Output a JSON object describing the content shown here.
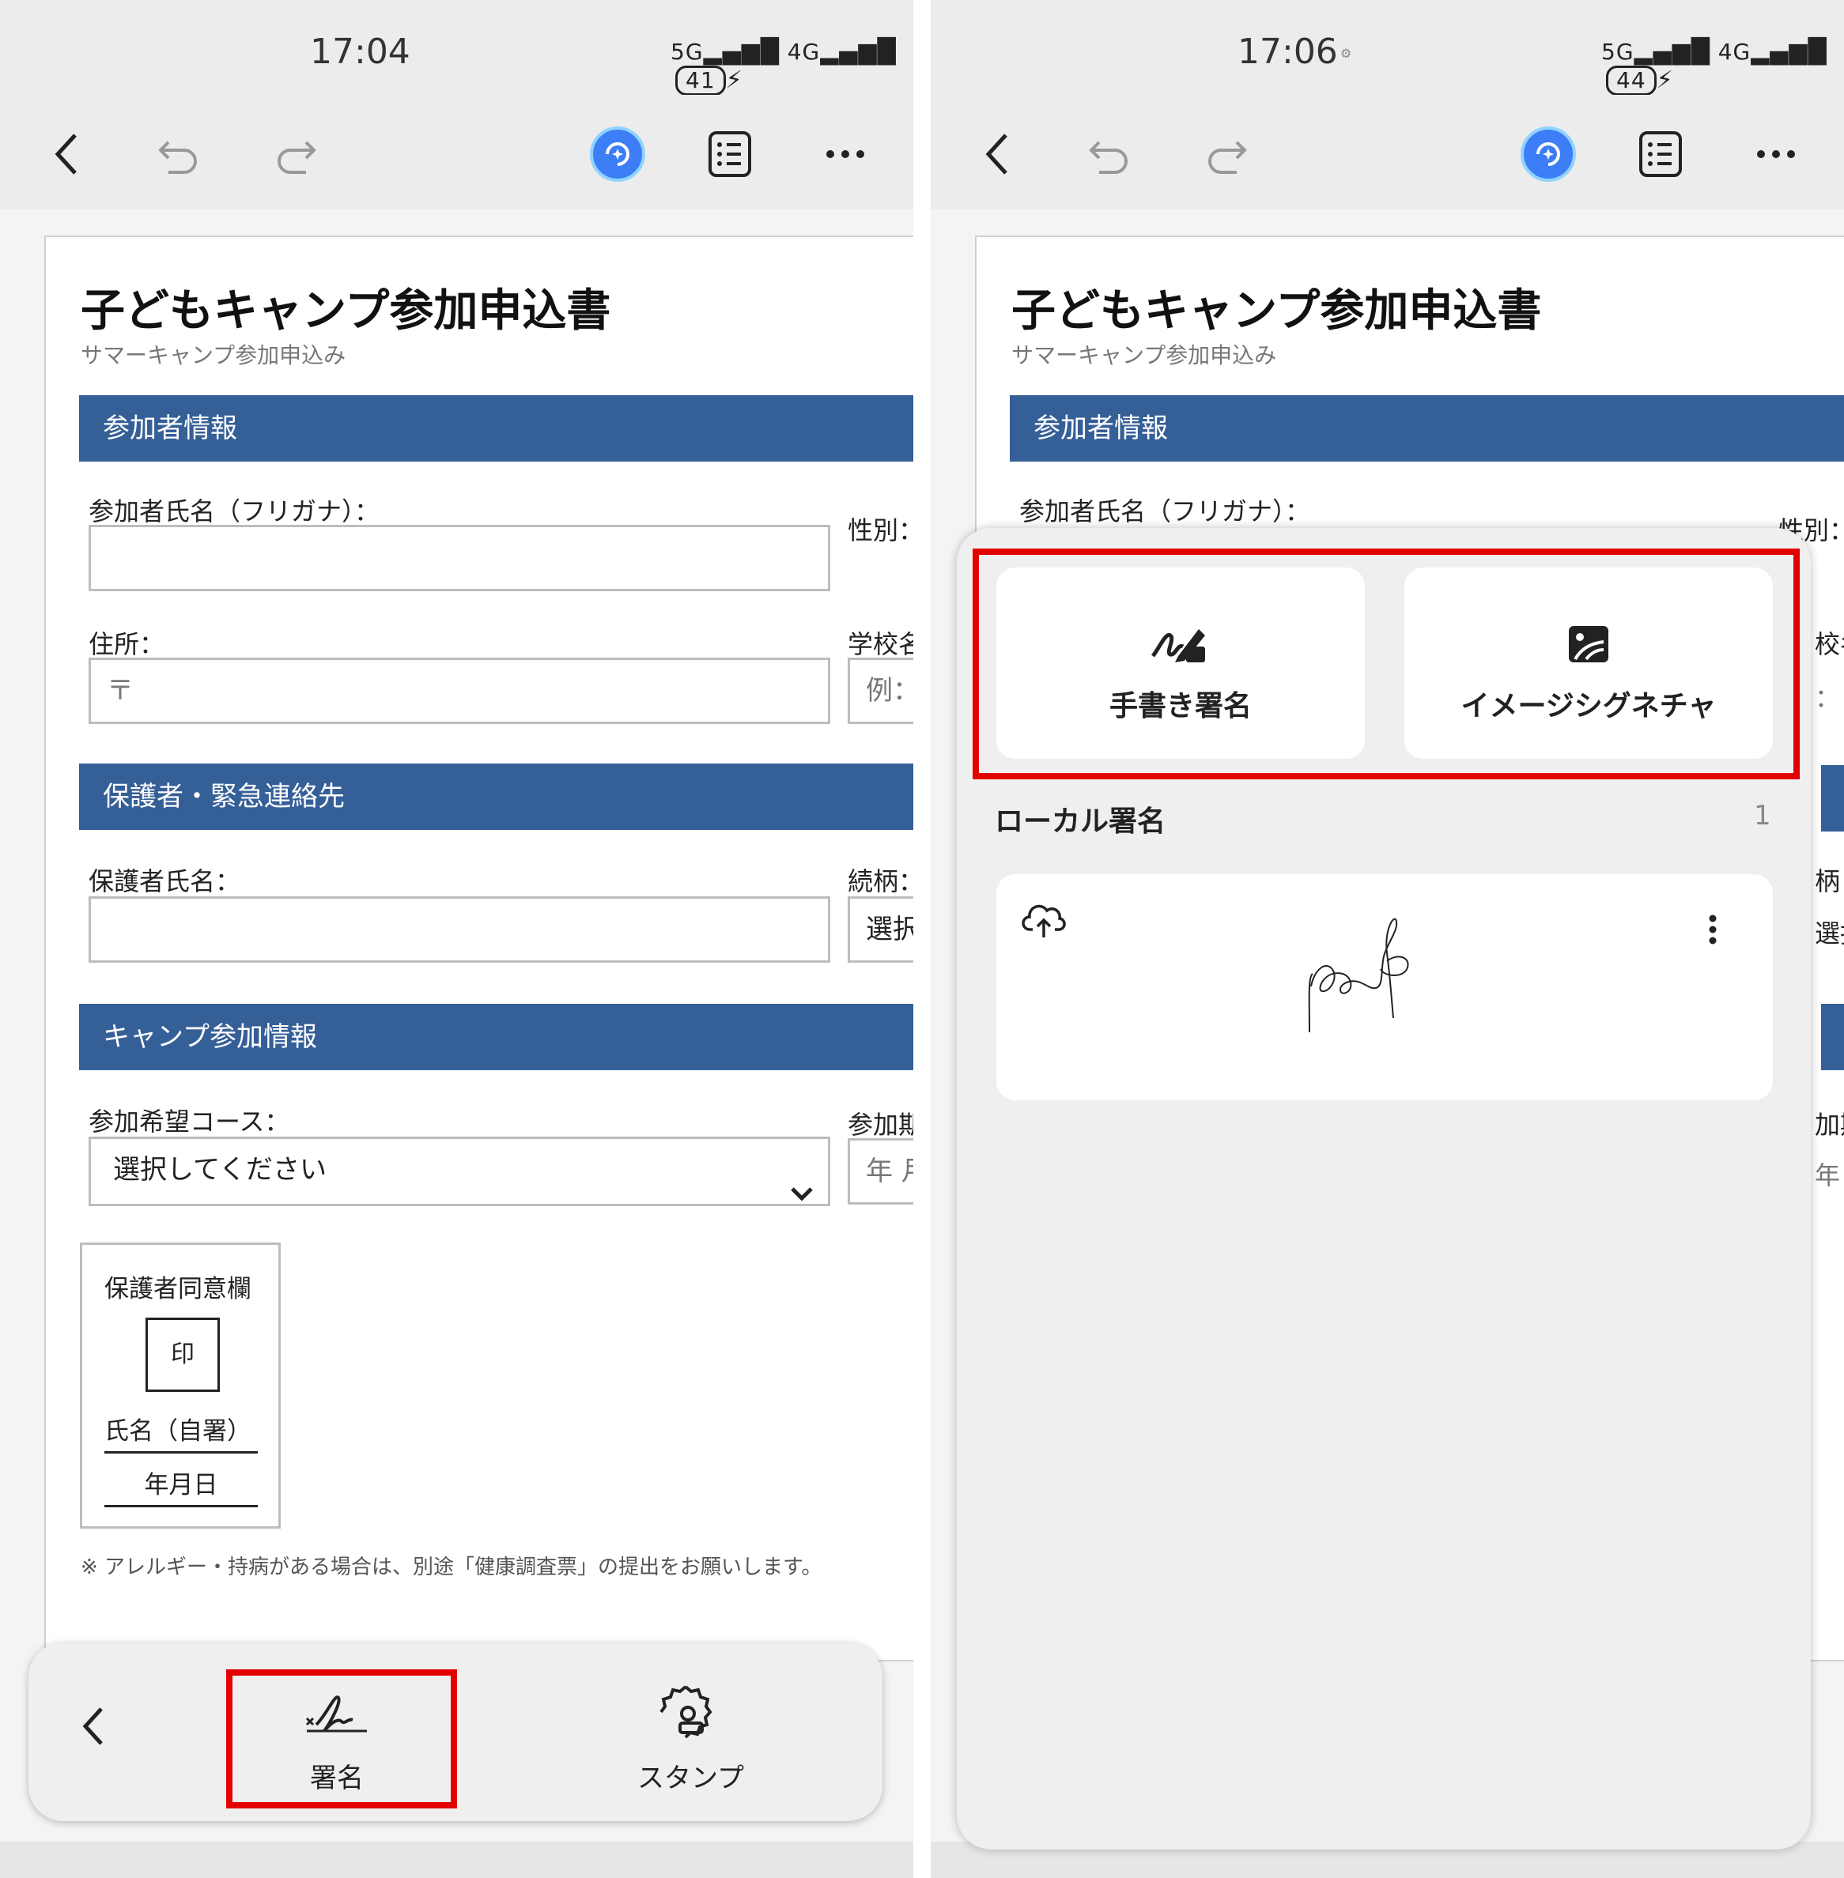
{
  "left_screen": {
    "status": {
      "time": "17:04",
      "network_5g": "5G",
      "network_4g": "4G",
      "battery": "41"
    },
    "document": {
      "title": "子どもキャンプ参加申込書",
      "subtitle": "サマーキャンプ参加申込み",
      "sections": {
        "participant": "参加者情報",
        "guardian": "保護者・緊急連絡先",
        "camp": "キャンプ参加情報"
      },
      "labels": {
        "name_kana": "参加者氏名（フリガナ）：",
        "gender": "性別：",
        "address": "住所：",
        "school": "学校名",
        "guardian_name": "保護者氏名：",
        "relation": "続柄：",
        "course": "参加希望コース：",
        "period": "参加期"
      },
      "fields": {
        "address_value": "〒",
        "school_placeholder": "例：",
        "relation_select": "選択",
        "course_select": "選択してください",
        "period_placeholder": "年 月"
      },
      "consent": {
        "title": "保護者同意欄",
        "seal": "印",
        "name": "氏名（自署）",
        "date": "年月日"
      },
      "note": "※ アレルギー・持病がある場合は、別途「健康調査票」の提出をお願いします。"
    },
    "bottom_toolbar": {
      "sign_label": "署名",
      "stamp_label": "スタンプ"
    }
  },
  "right_screen": {
    "status": {
      "time": "17:06",
      "network_5g": "5G",
      "network_4g": "4G",
      "battery": "44"
    },
    "document": {
      "title": "子どもキャンプ参加申込書",
      "subtitle": "サマーキャンプ参加申込み",
      "section_participant": "参加者情報",
      "label_name_kana": "参加者氏名（フリガナ）：",
      "label_gender": "性別：",
      "edge_school": "校名",
      "edge_school_ph": "：",
      "edge_relation": "柄：",
      "edge_relation_select": "選択",
      "edge_period": "加期",
      "edge_period_ph": "年 月"
    },
    "signature_sheet": {
      "handwritten_label": "手書き署名",
      "image_signature_label": "イメージシグネチャ",
      "local_signatures_title": "ローカル署名",
      "local_signatures_count": "1"
    }
  },
  "colors": {
    "section_blue": "#355f97",
    "highlight_red": "#e30000",
    "accent_ai": "#3d7df5"
  },
  "icons": [
    "back-icon",
    "undo-icon",
    "redo-icon",
    "ai-assistant-icon",
    "list-icon",
    "more-icon",
    "signature-icon",
    "stamp-icon",
    "handwriting-icon",
    "image-icon",
    "cloud-upload-icon",
    "kebab-icon",
    "chevron-down-icon"
  ]
}
